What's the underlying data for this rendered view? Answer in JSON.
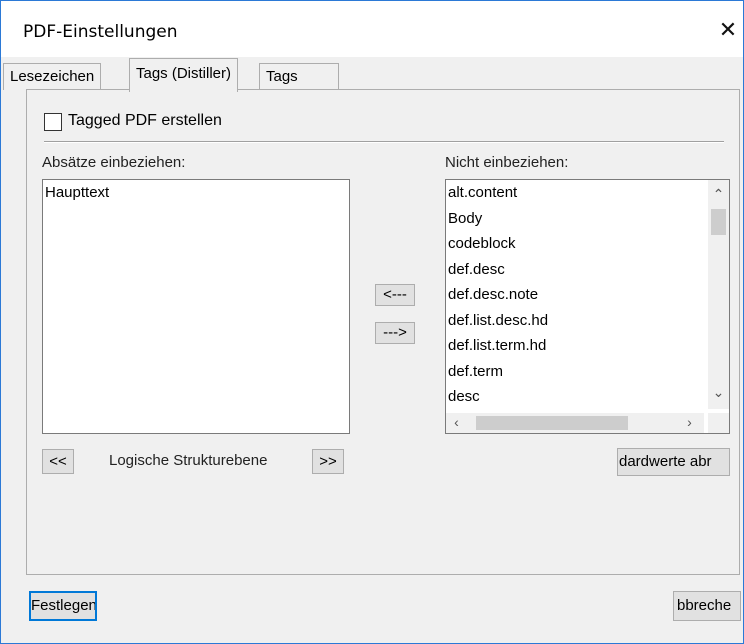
{
  "dialog": {
    "title": "PDF-Einstellungen",
    "close_glyph": "✕"
  },
  "tabs": [
    {
      "label": "Lesezeichen"
    },
    {
      "label": "Tags (Distiller)"
    },
    {
      "label": "Tags"
    }
  ],
  "panel": {
    "checkbox_label": "Tagged PDF erstellen",
    "checkbox_checked": false,
    "include_label": "Absätze einbeziehen:",
    "exclude_label": "Nicht einbeziehen:",
    "include_items": [
      "Haupttext"
    ],
    "exclude_items": [
      "alt.content",
      "Body",
      "codeblock",
      "def.desc",
      "def.desc.note",
      "def.list.desc.hd",
      "def.list.term.hd",
      "def.term",
      "desc"
    ],
    "move_left_label": "<---",
    "move_right_label": "--->",
    "level_down_label": "<<",
    "level_up_label": ">>",
    "level_label": "Logische Strukturebene",
    "defaults_label": "dardwerte abr"
  },
  "footer": {
    "ok_label": "Festlegen",
    "cancel_label": "bbreche"
  },
  "colors": {
    "focus_border": "#0078d7",
    "window_border": "#2b79d6"
  }
}
